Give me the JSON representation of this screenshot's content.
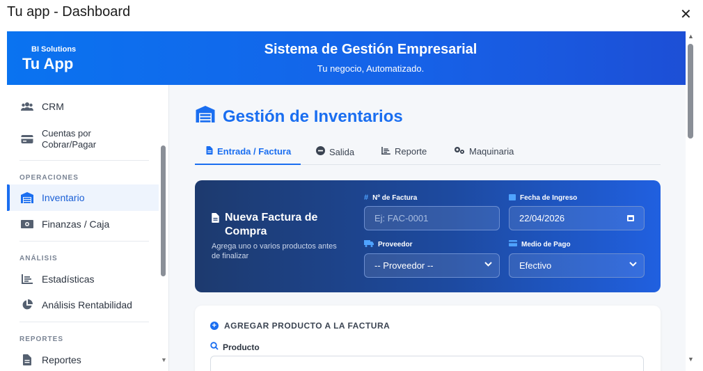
{
  "window": {
    "title": "Tu app - Dashboard",
    "close_glyph": "✕"
  },
  "header": {
    "brand_small": "BI Solutions",
    "brand_big": "Tu App",
    "title": "Sistema de Gestión Empresarial",
    "subtitle": "Tu negocio, Automatizado."
  },
  "sidebar": {
    "items": [
      {
        "label": "CRM",
        "icon": "users-icon"
      },
      {
        "label": "Cuentas por\nCobrar/Pagar",
        "icon": "credit-card-icon"
      },
      {
        "label": "Inventario",
        "icon": "warehouse-icon",
        "active": true
      },
      {
        "label": "Finanzas / Caja",
        "icon": "money-icon"
      },
      {
        "label": "Estadísticas",
        "icon": "chart-line-icon"
      },
      {
        "label": "Análisis Rentabilidad",
        "icon": "pie-chart-icon"
      },
      {
        "label": "Reportes",
        "icon": "file-icon"
      }
    ],
    "sections": {
      "operaciones": "OPERACIONES",
      "analisis": "ANÁLISIS",
      "reportes": "REPORTES"
    }
  },
  "main": {
    "page_title": "Gestión de Inventarios",
    "tabs": [
      {
        "label": "Entrada / Factura",
        "icon": "file-invoice-icon",
        "active": true
      },
      {
        "label": "Salida",
        "icon": "minus-circle-icon"
      },
      {
        "label": "Reporte",
        "icon": "list-icon"
      },
      {
        "label": "Maquinaria",
        "icon": "cogs-icon"
      }
    ],
    "invoice": {
      "title_line1": "Nueva Factura de",
      "title_line2": "Compra",
      "description": "Agrega uno o varios productos antes de finalizar",
      "fields": {
        "invoice_number": {
          "label": "Nº de Factura",
          "placeholder": "Ej: FAC-0001"
        },
        "entry_date": {
          "label": "Fecha de Ingreso",
          "value": "22/04/2026"
        },
        "supplier": {
          "label": "Proveedor",
          "value": "-- Proveedor --"
        },
        "payment_method": {
          "label": "Medio de Pago",
          "value": "Efectivo"
        }
      }
    },
    "add_product": {
      "title": "AGREGAR PRODUCTO A LA FACTURA",
      "product_label": "Producto"
    }
  },
  "colors": {
    "accent": "#1a6ef0",
    "header_start": "#0a73f0",
    "header_end": "#1d4fd6",
    "card_start": "#1d3a6e",
    "card_end": "#2060e0"
  }
}
